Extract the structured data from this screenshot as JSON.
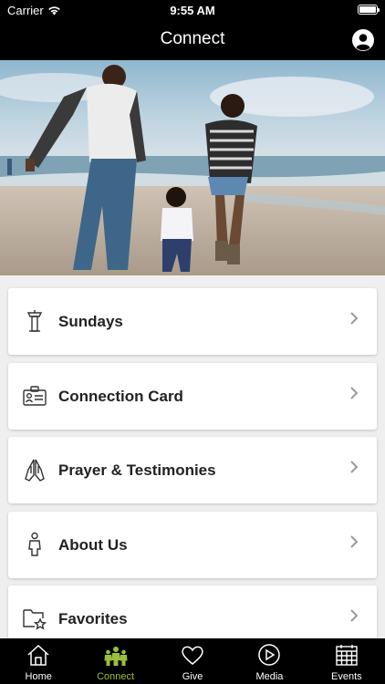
{
  "status_bar": {
    "carrier": "Carrier",
    "time": "9:55 AM",
    "battery_level": 1.0
  },
  "nav": {
    "title": "Connect",
    "profile_icon": "person-circle-icon"
  },
  "menu": [
    {
      "label": "Sundays",
      "icon": "podium-icon"
    },
    {
      "label": "Connection Card",
      "icon": "id-card-icon"
    },
    {
      "label": "Prayer & Testimonies",
      "icon": "praying-hands-icon"
    },
    {
      "label": "About Us",
      "icon": "person-icon"
    },
    {
      "label": "Favorites",
      "icon": "folder-star-icon"
    }
  ],
  "tabs": [
    {
      "label": "Home",
      "icon": "house-icon",
      "active": false
    },
    {
      "label": "Connect",
      "icon": "people-icon",
      "active": true
    },
    {
      "label": "Give",
      "icon": "heart-icon",
      "active": false
    },
    {
      "label": "Media",
      "icon": "play-circle-icon",
      "active": false
    },
    {
      "label": "Events",
      "icon": "calendar-icon",
      "active": false
    }
  ],
  "colors": {
    "accent": "#9bbf3b",
    "bar_bg": "#000000",
    "page_bg": "#efefef"
  }
}
